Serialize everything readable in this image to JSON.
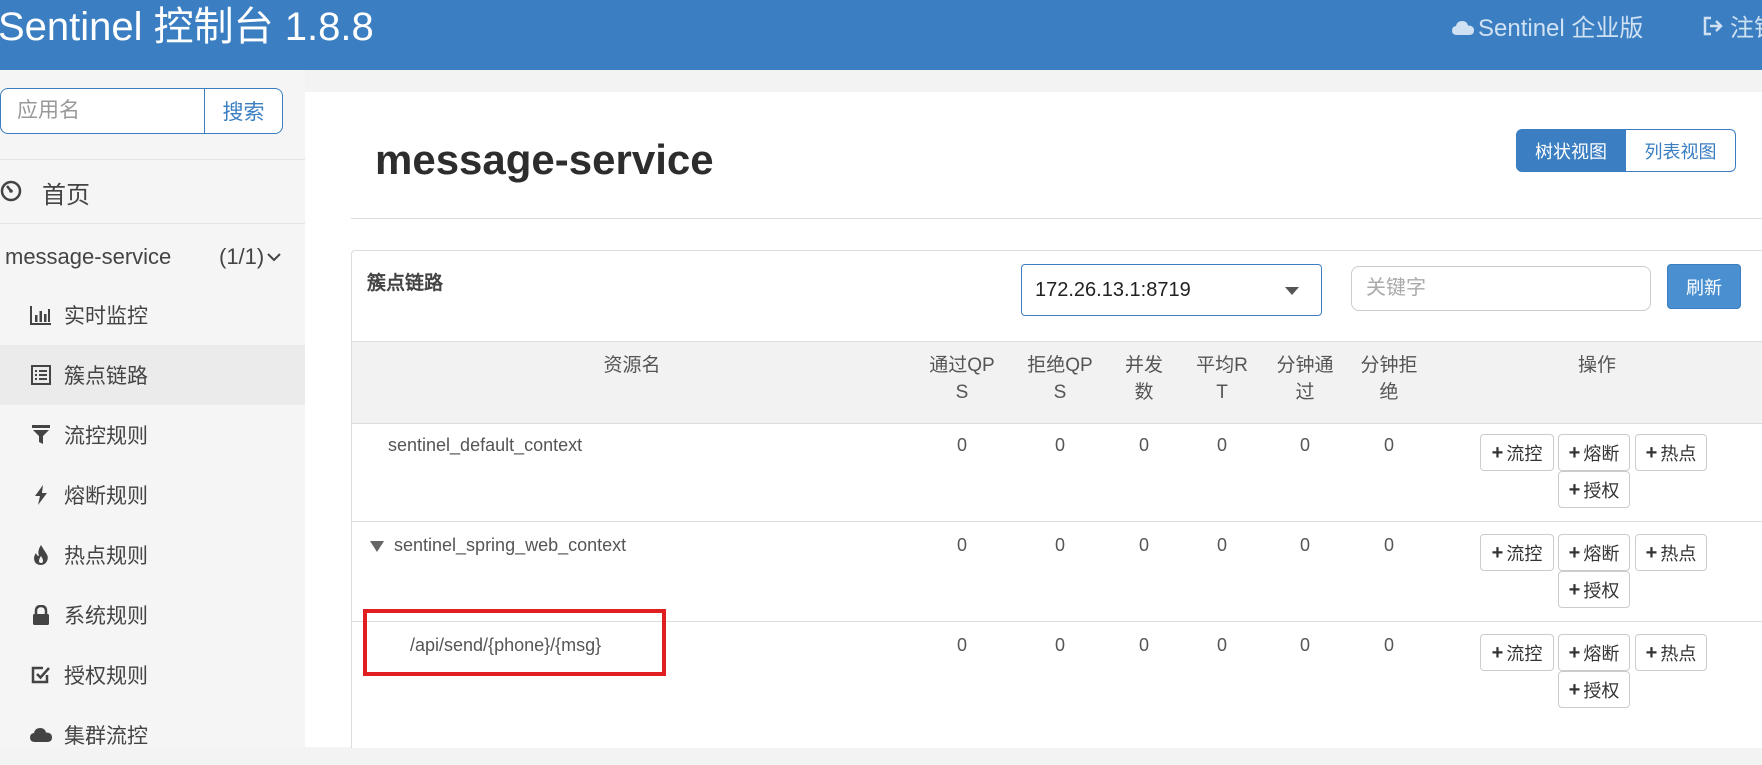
{
  "header": {
    "brand": "Sentinel 控制台 1.8.8",
    "enterprise": "Sentinel 企业版",
    "logout": "注销"
  },
  "sidebar": {
    "search_placeholder": "应用名",
    "search_button": "搜索",
    "home": "首页",
    "app": {
      "name": "message-service",
      "count": "(1/1)"
    },
    "items": [
      {
        "label": "实时监控",
        "icon": "bar-chart-icon"
      },
      {
        "label": "簇点链路",
        "icon": "list-icon"
      },
      {
        "label": "流控规则",
        "icon": "filter-icon"
      },
      {
        "label": "熔断规则",
        "icon": "bolt-icon"
      },
      {
        "label": "热点规则",
        "icon": "fire-icon"
      },
      {
        "label": "系统规则",
        "icon": "lock-icon"
      },
      {
        "label": "授权规则",
        "icon": "check-square-icon"
      },
      {
        "label": "集群流控",
        "icon": "cloud-icon"
      }
    ]
  },
  "main": {
    "title": "message-service",
    "view_tree": "树状视图",
    "view_list": "列表视图",
    "panel_title": "簇点链路",
    "machine_selected": "172.26.13.1:8719",
    "keyword_placeholder": "关键字",
    "refresh": "刷新"
  },
  "table": {
    "headers": {
      "resource": "资源名",
      "pass_qps_1": "通过QP",
      "pass_qps_2": "S",
      "block_qps_1": "拒绝QP",
      "block_qps_2": "S",
      "concurrency_1": "并发",
      "concurrency_2": "数",
      "avg_rt_1": "平均R",
      "avg_rt_2": "T",
      "min_pass_1": "分钟通",
      "min_pass_2": "过",
      "min_block_1": "分钟拒",
      "min_block_2": "绝",
      "ops": "操作"
    },
    "rows": [
      {
        "resource": "sentinel_default_context",
        "values": [
          "0",
          "0",
          "0",
          "0",
          "0",
          "0"
        ]
      },
      {
        "resource": "sentinel_spring_web_context",
        "values": [
          "0",
          "0",
          "0",
          "0",
          "0",
          "0"
        ]
      },
      {
        "resource": "/api/send/{phone}/{msg}",
        "values": [
          "0",
          "0",
          "0",
          "0",
          "0",
          "0"
        ]
      }
    ],
    "ops": {
      "flow": "流控",
      "degrade": "熔断",
      "hot": "热点",
      "auth": "授权"
    }
  },
  "colors": {
    "primary": "#3b7fc2",
    "highlight": "#e02020"
  }
}
